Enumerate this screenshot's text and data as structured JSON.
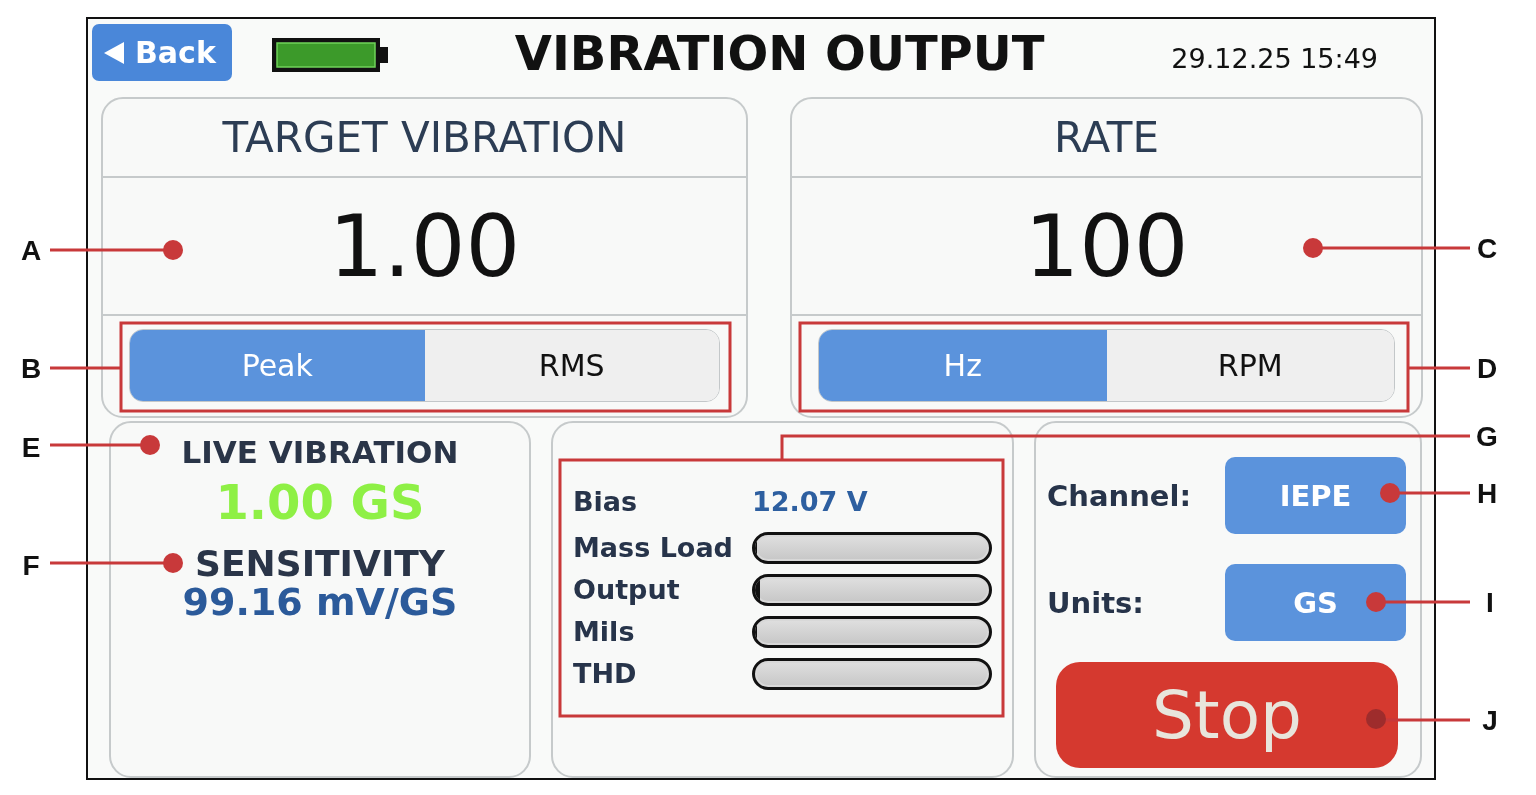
{
  "header": {
    "back_button": "Back",
    "title": "VIBRATION OUTPUT",
    "datetime": "29.12.25 15:49"
  },
  "target_vibration": {
    "title": "TARGET VIBRATION",
    "value": "1.00",
    "modes": [
      {
        "label": "Peak",
        "selected": true
      },
      {
        "label": "RMS",
        "selected": false
      }
    ]
  },
  "rate": {
    "title": "RATE",
    "value": "100",
    "units": [
      {
        "label": "Hz",
        "selected": true
      },
      {
        "label": "RPM",
        "selected": false
      }
    ]
  },
  "live_vibration": {
    "title": "LIVE VIBRATION",
    "value": "1.00 GS",
    "sensitivity_title": "SENSITIVITY",
    "sensitivity_value": "99.16 mV/GS"
  },
  "diagnostics": {
    "bias": {
      "label": "Bias",
      "value": "12.07 V"
    },
    "meters": [
      {
        "label": "Mass Load",
        "level": 0.01
      },
      {
        "label": "Output",
        "level": 0.02
      },
      {
        "label": "Mils",
        "level": 0.01
      },
      {
        "label": "THD"
      }
    ]
  },
  "settings": {
    "channel": {
      "label": "Channel:",
      "value": "IEPE"
    },
    "units": {
      "label": "Units:",
      "value": "GS"
    },
    "stop_button": "Stop"
  },
  "callouts": [
    {
      "letter": "A",
      "kind": "dot"
    },
    {
      "letter": "B",
      "kind": "frame"
    },
    {
      "letter": "E",
      "kind": "dot"
    },
    {
      "letter": "F",
      "kind": "dot"
    },
    {
      "letter": "C",
      "kind": "dot"
    },
    {
      "letter": "D",
      "kind": "frame"
    },
    {
      "letter": "G",
      "kind": "frame"
    },
    {
      "letter": "H",
      "kind": "dot"
    },
    {
      "letter": "I",
      "kind": "dot"
    },
    {
      "letter": "J",
      "kind": "dot"
    }
  ]
}
